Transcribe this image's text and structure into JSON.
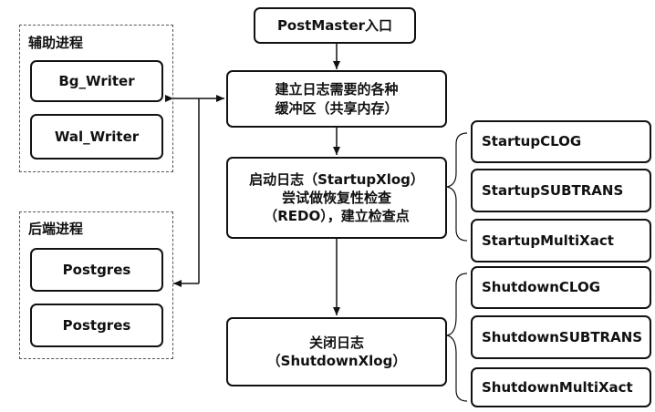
{
  "entry": "PostMaster入口",
  "init_log_line1": "建立日志需要的各种",
  "init_log_line2": "缓冲区（共享内存）",
  "startup_line1": "启动日志（StartupXlog）",
  "startup_line2": "尝试做恢复性检查",
  "startup_line3": "（REDO），建立检查点",
  "shutdown_line1": "关闭日志",
  "shutdown_line2": "（ShutdownXlog）",
  "aux_group": {
    "title": "辅助进程",
    "items": [
      "Bg_Writer",
      "Wal_Writer"
    ]
  },
  "backend_group": {
    "title": "后端进程",
    "items": [
      "Postgres",
      "Postgres"
    ]
  },
  "startup_items": [
    "StartupCLOG",
    "StartupSUBTRANS",
    "StartupMultiXact"
  ],
  "shutdown_items": [
    "ShutdownCLOG",
    "ShutdownSUBTRANS",
    "ShutdownMultiXact"
  ]
}
